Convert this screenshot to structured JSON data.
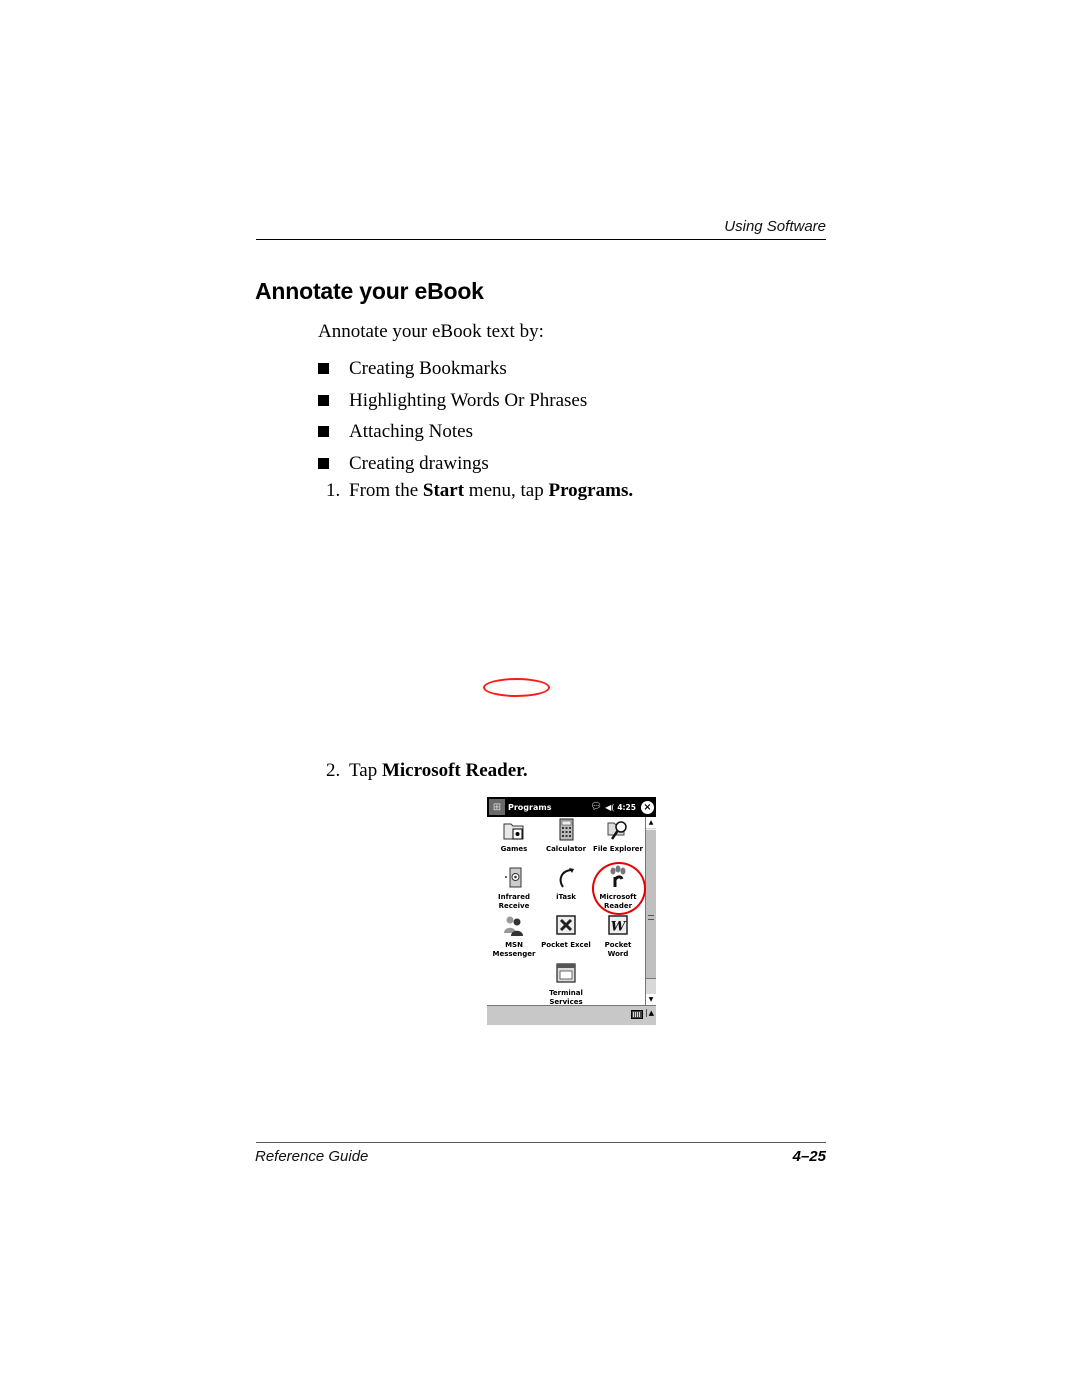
{
  "header": {
    "running_head": "Using Software"
  },
  "section": {
    "title": "Annotate your eBook",
    "intro": "Annotate your eBook text by:",
    "bullets": [
      "Creating Bookmarks",
      "Highlighting Words Or Phrases",
      "Attaching Notes",
      "Creating drawings"
    ],
    "steps": [
      {
        "number": "1.",
        "before": "From the ",
        "bold1": "Start",
        "middle": " menu, tap ",
        "bold2": "Programs."
      },
      {
        "number": "2.",
        "before": "Tap ",
        "bold1": "Microsoft Reader."
      }
    ]
  },
  "annotation_colors": {
    "highlight_circle": "#e60000"
  },
  "device_screen": {
    "title": "Programs",
    "time": "4:25",
    "status_icons": [
      "connectivity-icon",
      "speaker-icon",
      "close-icon"
    ],
    "programs": [
      {
        "label": "Games",
        "icon": "games-folder-icon"
      },
      {
        "label": "Calculator",
        "icon": "calculator-icon"
      },
      {
        "label": "File Explorer",
        "icon": "file-explorer-icon"
      },
      {
        "label": "Infrared Receive",
        "icon": "infrared-icon"
      },
      {
        "label": "iTask",
        "icon": "itask-icon"
      },
      {
        "label": "Microsoft Reader",
        "icon": "reader-icon"
      },
      {
        "label": "MSN Messenger",
        "icon": "messenger-icon"
      },
      {
        "label": "Pocket Excel",
        "icon": "excel-icon"
      },
      {
        "label": "Pocket Word",
        "icon": "word-icon"
      },
      {
        "label": "Terminal Services",
        "icon": "terminal-services-icon"
      }
    ],
    "program_labels_wrapped": [
      [
        "Games"
      ],
      [
        "Calculator"
      ],
      [
        "File Explorer"
      ],
      [
        "Infrared",
        "Receive"
      ],
      [
        "iTask"
      ],
      [
        "Microsoft",
        "Reader"
      ],
      [
        "MSN",
        "Messenger"
      ],
      [
        "Pocket Excel"
      ],
      [
        "Pocket",
        "Word"
      ],
      [
        "Terminal",
        "Services"
      ]
    ]
  },
  "footer": {
    "left": "Reference Guide",
    "page_number": "4–25"
  }
}
